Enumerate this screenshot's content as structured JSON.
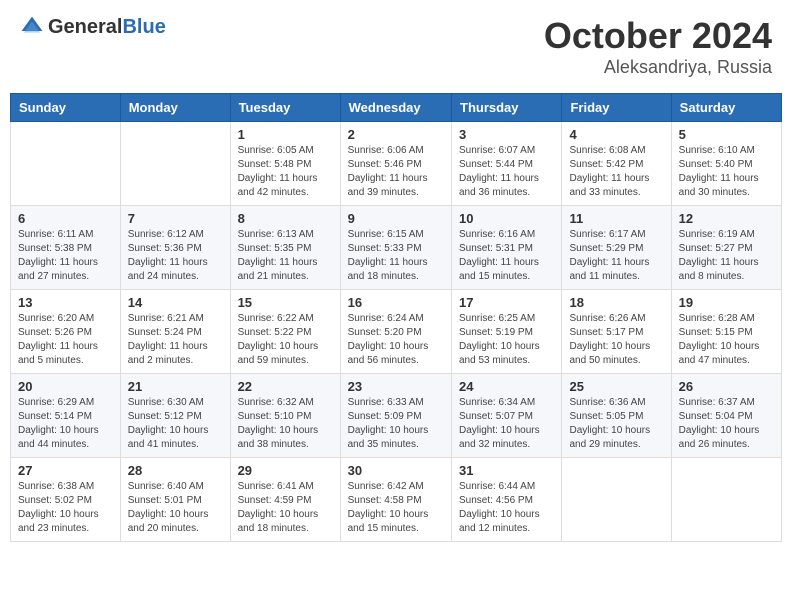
{
  "header": {
    "logo_general": "General",
    "logo_blue": "Blue",
    "month": "October 2024",
    "location": "Aleksandriya, Russia"
  },
  "days_of_week": [
    "Sunday",
    "Monday",
    "Tuesday",
    "Wednesday",
    "Thursday",
    "Friday",
    "Saturday"
  ],
  "weeks": [
    [
      {
        "day": "",
        "sunrise": "",
        "sunset": "",
        "daylight": ""
      },
      {
        "day": "",
        "sunrise": "",
        "sunset": "",
        "daylight": ""
      },
      {
        "day": "1",
        "sunrise": "Sunrise: 6:05 AM",
        "sunset": "Sunset: 5:48 PM",
        "daylight": "Daylight: 11 hours and 42 minutes."
      },
      {
        "day": "2",
        "sunrise": "Sunrise: 6:06 AM",
        "sunset": "Sunset: 5:46 PM",
        "daylight": "Daylight: 11 hours and 39 minutes."
      },
      {
        "day": "3",
        "sunrise": "Sunrise: 6:07 AM",
        "sunset": "Sunset: 5:44 PM",
        "daylight": "Daylight: 11 hours and 36 minutes."
      },
      {
        "day": "4",
        "sunrise": "Sunrise: 6:08 AM",
        "sunset": "Sunset: 5:42 PM",
        "daylight": "Daylight: 11 hours and 33 minutes."
      },
      {
        "day": "5",
        "sunrise": "Sunrise: 6:10 AM",
        "sunset": "Sunset: 5:40 PM",
        "daylight": "Daylight: 11 hours and 30 minutes."
      }
    ],
    [
      {
        "day": "6",
        "sunrise": "Sunrise: 6:11 AM",
        "sunset": "Sunset: 5:38 PM",
        "daylight": "Daylight: 11 hours and 27 minutes."
      },
      {
        "day": "7",
        "sunrise": "Sunrise: 6:12 AM",
        "sunset": "Sunset: 5:36 PM",
        "daylight": "Daylight: 11 hours and 24 minutes."
      },
      {
        "day": "8",
        "sunrise": "Sunrise: 6:13 AM",
        "sunset": "Sunset: 5:35 PM",
        "daylight": "Daylight: 11 hours and 21 minutes."
      },
      {
        "day": "9",
        "sunrise": "Sunrise: 6:15 AM",
        "sunset": "Sunset: 5:33 PM",
        "daylight": "Daylight: 11 hours and 18 minutes."
      },
      {
        "day": "10",
        "sunrise": "Sunrise: 6:16 AM",
        "sunset": "Sunset: 5:31 PM",
        "daylight": "Daylight: 11 hours and 15 minutes."
      },
      {
        "day": "11",
        "sunrise": "Sunrise: 6:17 AM",
        "sunset": "Sunset: 5:29 PM",
        "daylight": "Daylight: 11 hours and 11 minutes."
      },
      {
        "day": "12",
        "sunrise": "Sunrise: 6:19 AM",
        "sunset": "Sunset: 5:27 PM",
        "daylight": "Daylight: 11 hours and 8 minutes."
      }
    ],
    [
      {
        "day": "13",
        "sunrise": "Sunrise: 6:20 AM",
        "sunset": "Sunset: 5:26 PM",
        "daylight": "Daylight: 11 hours and 5 minutes."
      },
      {
        "day": "14",
        "sunrise": "Sunrise: 6:21 AM",
        "sunset": "Sunset: 5:24 PM",
        "daylight": "Daylight: 11 hours and 2 minutes."
      },
      {
        "day": "15",
        "sunrise": "Sunrise: 6:22 AM",
        "sunset": "Sunset: 5:22 PM",
        "daylight": "Daylight: 10 hours and 59 minutes."
      },
      {
        "day": "16",
        "sunrise": "Sunrise: 6:24 AM",
        "sunset": "Sunset: 5:20 PM",
        "daylight": "Daylight: 10 hours and 56 minutes."
      },
      {
        "day": "17",
        "sunrise": "Sunrise: 6:25 AM",
        "sunset": "Sunset: 5:19 PM",
        "daylight": "Daylight: 10 hours and 53 minutes."
      },
      {
        "day": "18",
        "sunrise": "Sunrise: 6:26 AM",
        "sunset": "Sunset: 5:17 PM",
        "daylight": "Daylight: 10 hours and 50 minutes."
      },
      {
        "day": "19",
        "sunrise": "Sunrise: 6:28 AM",
        "sunset": "Sunset: 5:15 PM",
        "daylight": "Daylight: 10 hours and 47 minutes."
      }
    ],
    [
      {
        "day": "20",
        "sunrise": "Sunrise: 6:29 AM",
        "sunset": "Sunset: 5:14 PM",
        "daylight": "Daylight: 10 hours and 44 minutes."
      },
      {
        "day": "21",
        "sunrise": "Sunrise: 6:30 AM",
        "sunset": "Sunset: 5:12 PM",
        "daylight": "Daylight: 10 hours and 41 minutes."
      },
      {
        "day": "22",
        "sunrise": "Sunrise: 6:32 AM",
        "sunset": "Sunset: 5:10 PM",
        "daylight": "Daylight: 10 hours and 38 minutes."
      },
      {
        "day": "23",
        "sunrise": "Sunrise: 6:33 AM",
        "sunset": "Sunset: 5:09 PM",
        "daylight": "Daylight: 10 hours and 35 minutes."
      },
      {
        "day": "24",
        "sunrise": "Sunrise: 6:34 AM",
        "sunset": "Sunset: 5:07 PM",
        "daylight": "Daylight: 10 hours and 32 minutes."
      },
      {
        "day": "25",
        "sunrise": "Sunrise: 6:36 AM",
        "sunset": "Sunset: 5:05 PM",
        "daylight": "Daylight: 10 hours and 29 minutes."
      },
      {
        "day": "26",
        "sunrise": "Sunrise: 6:37 AM",
        "sunset": "Sunset: 5:04 PM",
        "daylight": "Daylight: 10 hours and 26 minutes."
      }
    ],
    [
      {
        "day": "27",
        "sunrise": "Sunrise: 6:38 AM",
        "sunset": "Sunset: 5:02 PM",
        "daylight": "Daylight: 10 hours and 23 minutes."
      },
      {
        "day": "28",
        "sunrise": "Sunrise: 6:40 AM",
        "sunset": "Sunset: 5:01 PM",
        "daylight": "Daylight: 10 hours and 20 minutes."
      },
      {
        "day": "29",
        "sunrise": "Sunrise: 6:41 AM",
        "sunset": "Sunset: 4:59 PM",
        "daylight": "Daylight: 10 hours and 18 minutes."
      },
      {
        "day": "30",
        "sunrise": "Sunrise: 6:42 AM",
        "sunset": "Sunset: 4:58 PM",
        "daylight": "Daylight: 10 hours and 15 minutes."
      },
      {
        "day": "31",
        "sunrise": "Sunrise: 6:44 AM",
        "sunset": "Sunset: 4:56 PM",
        "daylight": "Daylight: 10 hours and 12 minutes."
      },
      {
        "day": "",
        "sunrise": "",
        "sunset": "",
        "daylight": ""
      },
      {
        "day": "",
        "sunrise": "",
        "sunset": "",
        "daylight": ""
      }
    ]
  ]
}
